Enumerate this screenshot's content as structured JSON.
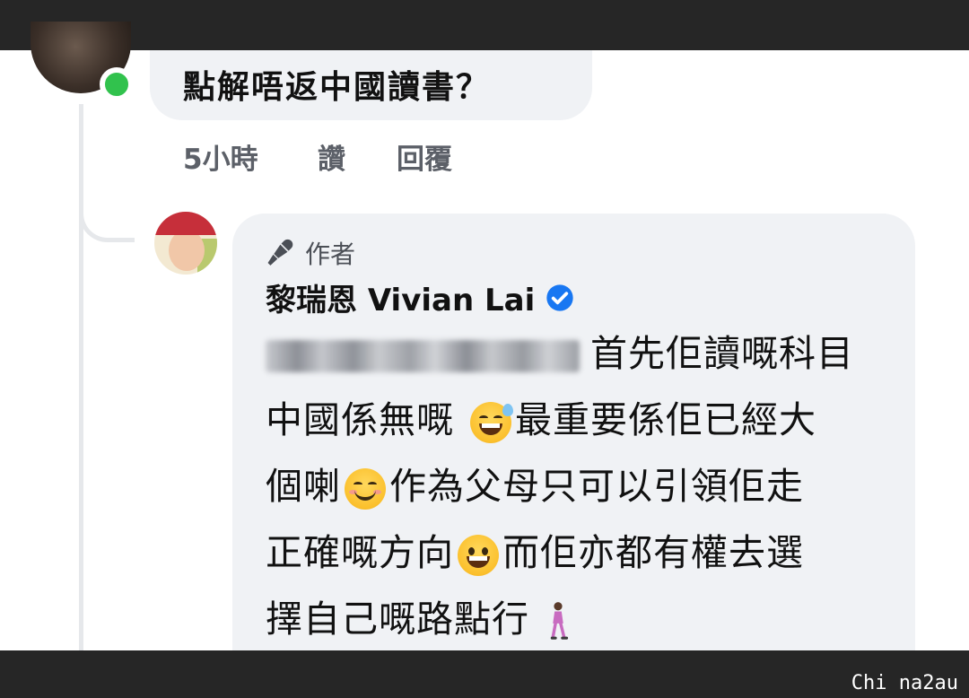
{
  "parent_comment": {
    "text": "點解唔返中國讀書？",
    "time": "5小時",
    "like_label": "讚",
    "reply_label": "回覆"
  },
  "reply": {
    "author_badge": "作者",
    "name": "黎瑞恩 Vivian Lai",
    "lines": [
      "首先佢讀嘅科目",
      "中國係無嘅",
      "最重要係佢已經大",
      "個喇",
      "作為父母只可以引領佢走",
      "正確嘅方向",
      "而佢亦都有權去選",
      "擇自己嘅路點行"
    ],
    "icons": [
      "mic-icon",
      "verified-icon",
      "grinning-sweat-emoji",
      "smiling-face-emoji",
      "grinning-face-emoji",
      "woman-walking-emoji"
    ]
  },
  "watermark": "Chi na2au",
  "colors": {
    "bubble": "#f0f2f5",
    "online": "#31c24d",
    "verified": "#1877f2",
    "frame": "#262626"
  }
}
